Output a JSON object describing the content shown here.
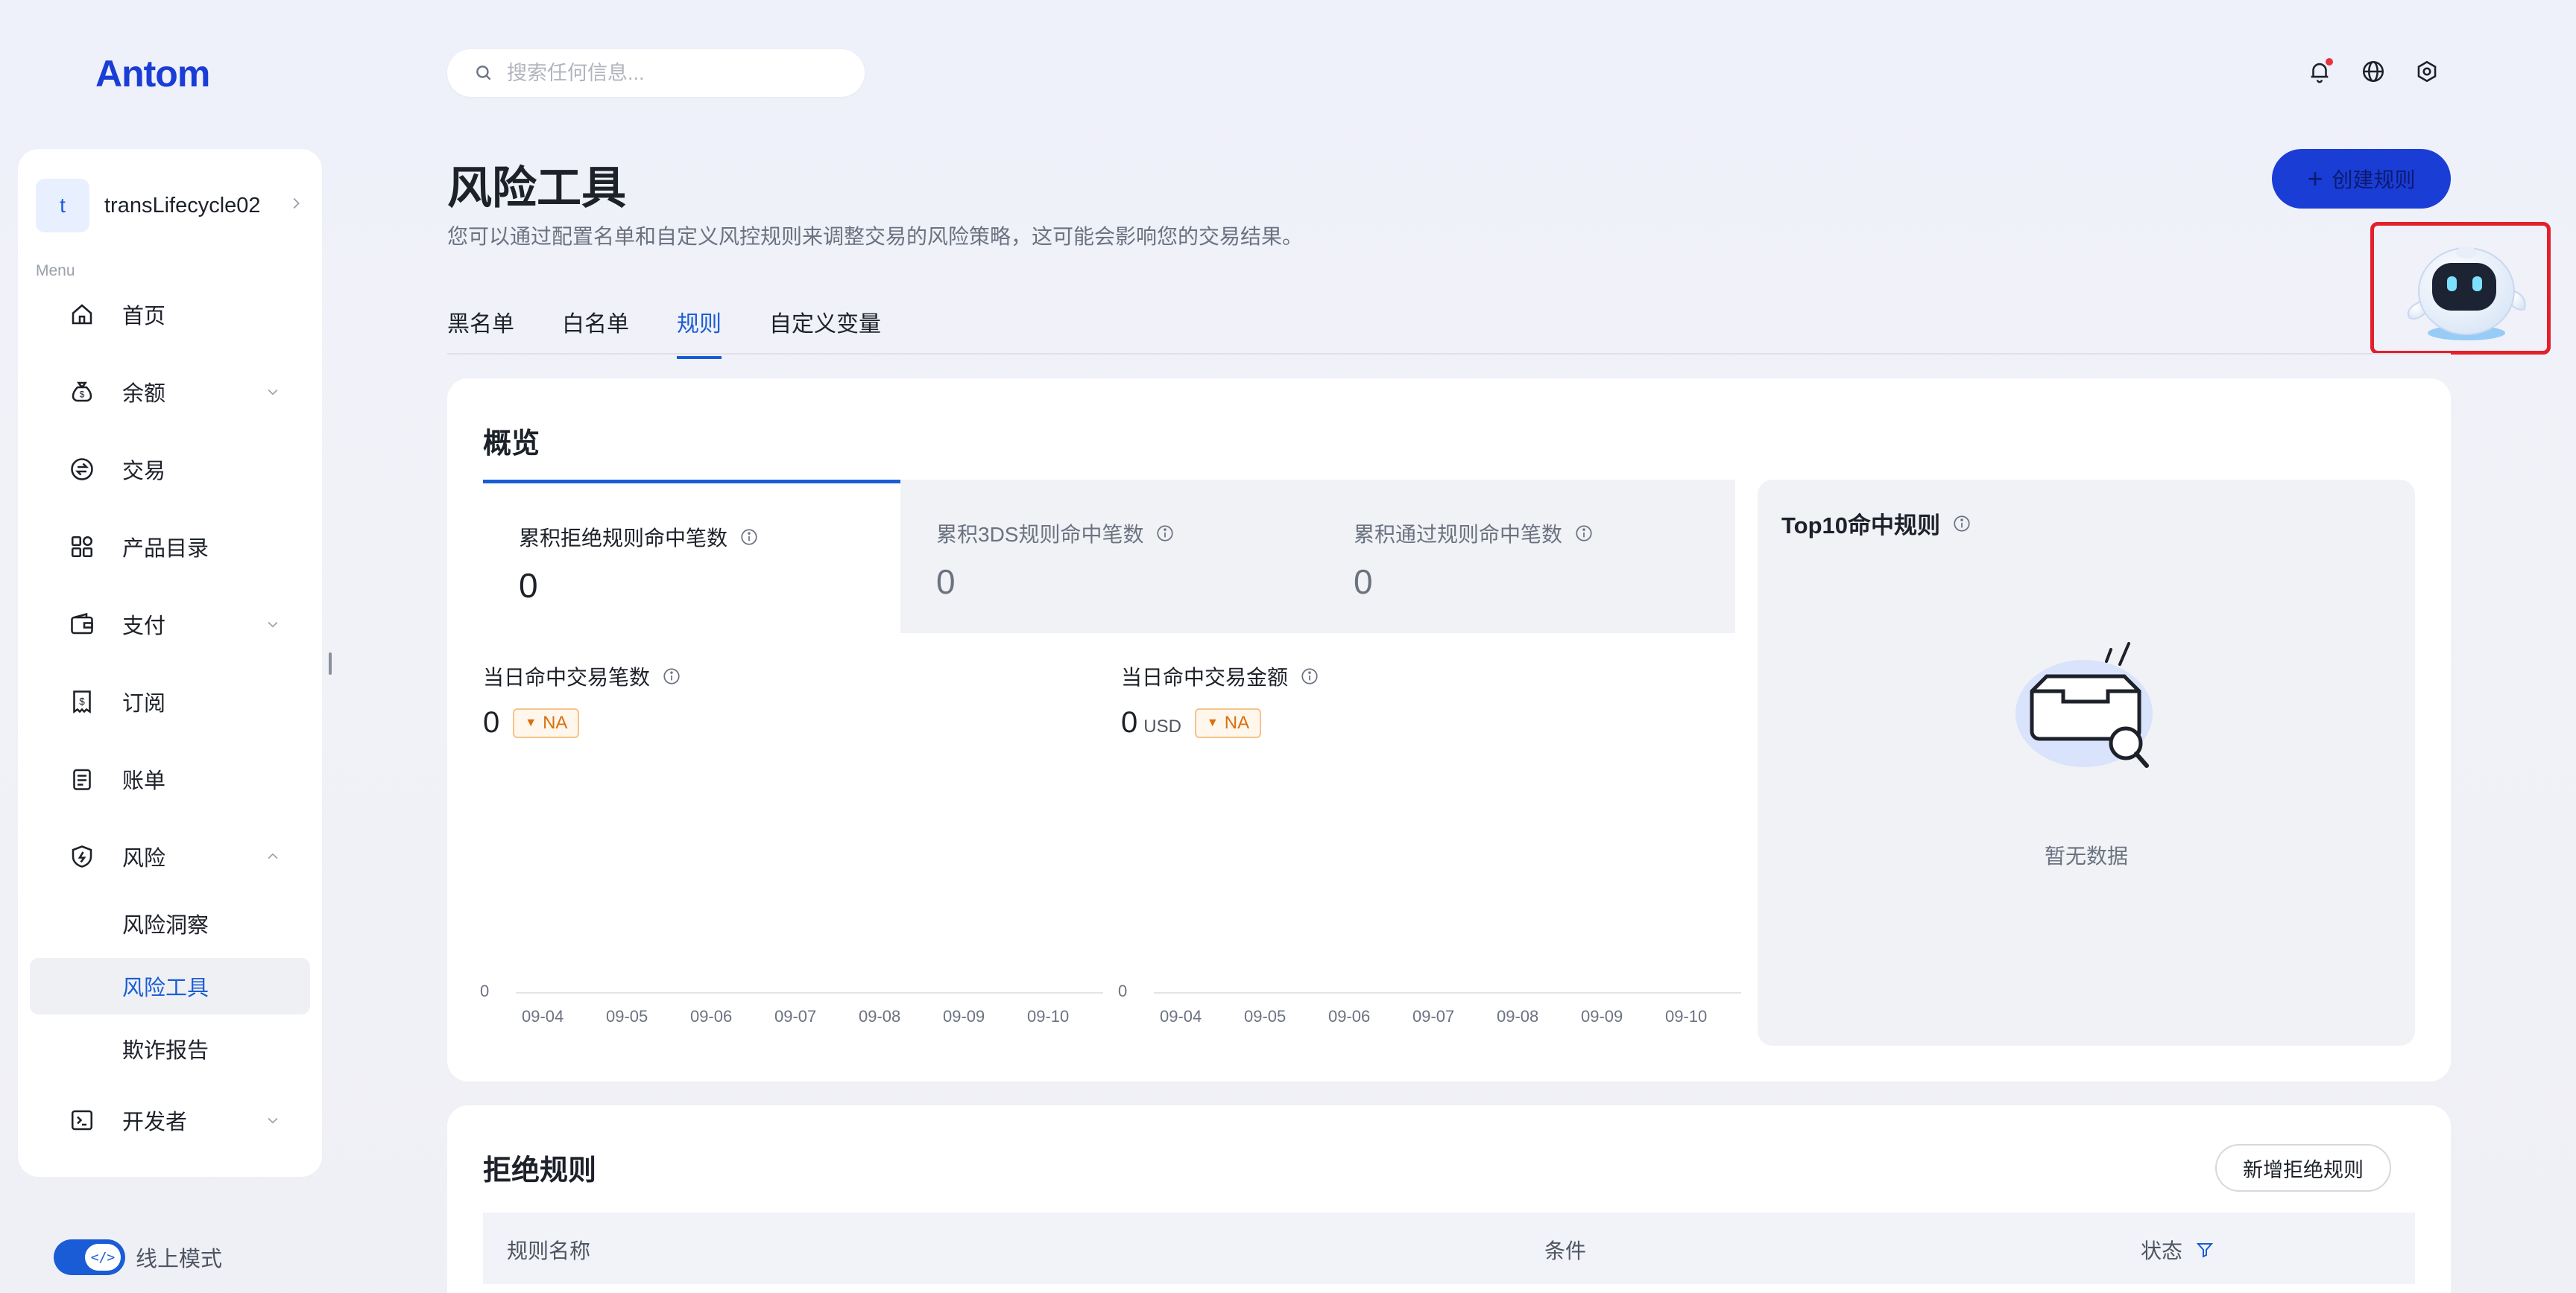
{
  "brand": {
    "logo": "Antom"
  },
  "search": {
    "placeholder": "搜索任何信息..."
  },
  "sidebar": {
    "account": {
      "avatar_letter": "t",
      "name": "transLifecycle02"
    },
    "menu_label": "Menu",
    "items": [
      {
        "label": "首页",
        "icon": "home-icon"
      },
      {
        "label": "余额",
        "icon": "money-bag-icon"
      },
      {
        "label": "交易",
        "icon": "exchange-icon"
      },
      {
        "label": "产品目录",
        "icon": "catalog-icon"
      },
      {
        "label": "支付",
        "icon": "wallet-icon"
      },
      {
        "label": "订阅",
        "icon": "receipt-icon"
      },
      {
        "label": "账单",
        "icon": "bill-icon"
      },
      {
        "label": "风险",
        "icon": "shield-icon"
      },
      {
        "label": "开发者",
        "icon": "terminal-icon"
      }
    ],
    "risk_sub": [
      "风险洞察",
      "风险工具",
      "欺诈报告"
    ],
    "mode": {
      "toggle_glyph": "</>",
      "label": "线上模式"
    }
  },
  "page": {
    "title": "风险工具",
    "description": "您可以通过配置名单和自定义风控规则来调整交易的风险策略，这可能会影响您的交易结果。",
    "create_button": "创建规则",
    "tabs": [
      "黑名单",
      "白名单",
      "规则",
      "自定义变量"
    ],
    "active_tab": "规则"
  },
  "overview": {
    "title": "概览",
    "stats": [
      {
        "label": "累积拒绝规则命中笔数",
        "value": "0"
      },
      {
        "label": "累积3DS规则命中笔数",
        "value": "0"
      },
      {
        "label": "累积通过规则命中笔数",
        "value": "0"
      }
    ],
    "daily_count": {
      "label": "当日命中交易笔数",
      "value": "0",
      "badge": "NA"
    },
    "daily_amount": {
      "label": "当日命中交易金额",
      "value": "0",
      "unit": "USD",
      "badge": "NA"
    },
    "chart_zero": "0",
    "dates": [
      "09-04",
      "09-05",
      "09-06",
      "09-07",
      "09-08",
      "09-09",
      "09-10"
    ],
    "top10": {
      "title": "Top10命中规则",
      "empty_text": "暂无数据"
    }
  },
  "reject_rules": {
    "title": "拒绝规则",
    "add_button": "新增拒绝规则",
    "columns": [
      "规则名称",
      "条件",
      "状态"
    ]
  },
  "colors": {
    "primary": "#1a5cd6",
    "button": "#1a3dd6",
    "highlight_box": "#e3202b",
    "badge_orange": "#d9700f"
  }
}
